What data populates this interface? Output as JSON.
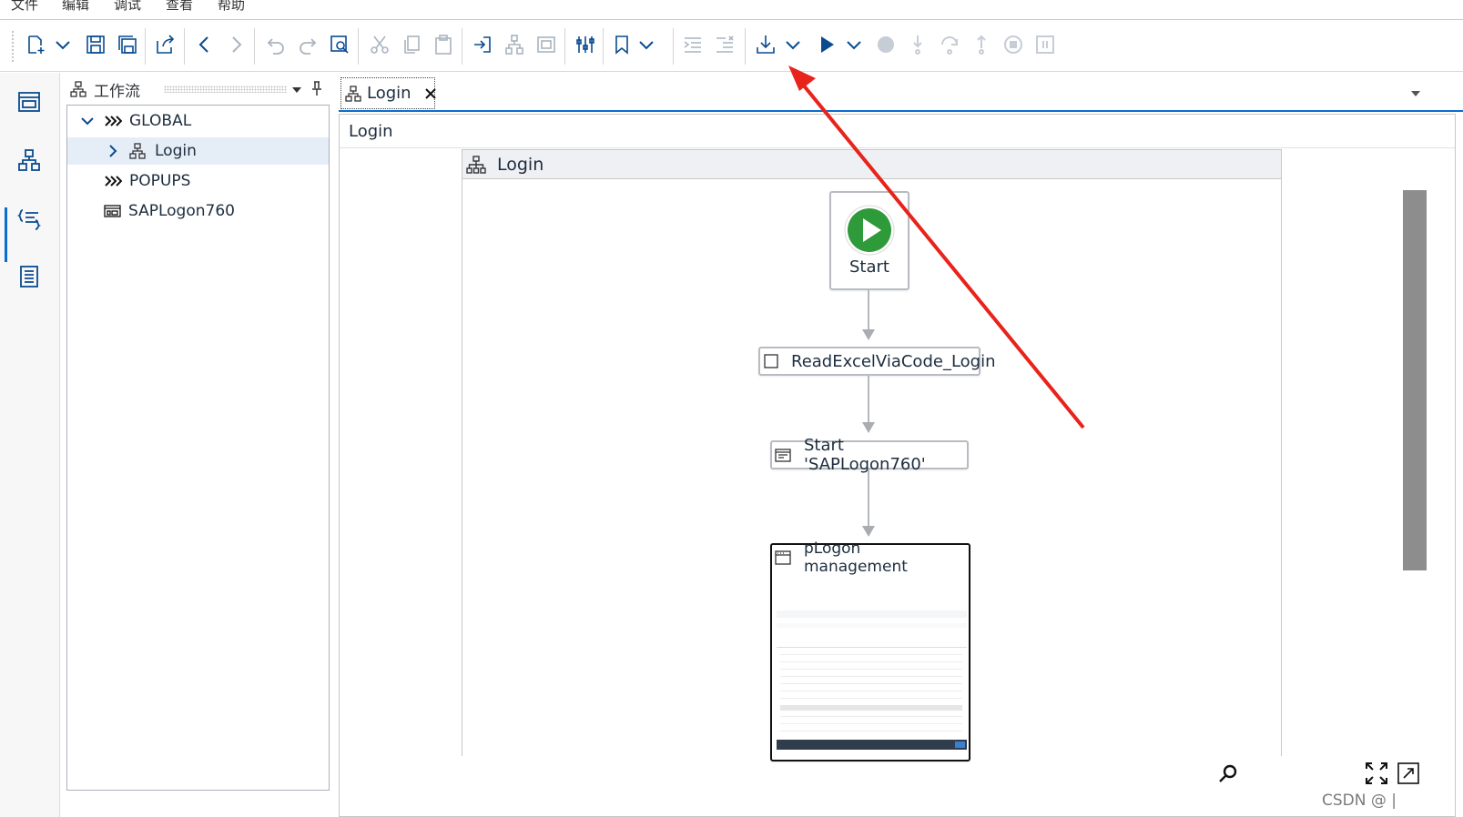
{
  "menu": [
    "文件",
    "编辑",
    "调试",
    "查看",
    "帮助"
  ],
  "toolbar_icons": [
    "new-file-icon",
    "dropdown-icon",
    "save-icon",
    "save-all-icon",
    "export-icon",
    "back-icon",
    "forward-icon",
    "undo-icon",
    "redo-icon",
    "find-icon",
    "cut-icon",
    "copy-icon",
    "paste-icon",
    "insert-icon",
    "group-icon",
    "frame-icon",
    "settings-sliders-icon",
    "bookmark-icon",
    "indent-icon",
    "outdent-icon",
    "download-deploy-icon",
    "run-icon",
    "breakpoint-icon",
    "step-into-icon",
    "step-over-icon",
    "step-out-icon",
    "stop-icon",
    "pause-icon"
  ],
  "workflow_panel": {
    "title": "工作流",
    "tree": [
      {
        "label": "GLOBAL",
        "expanded": true
      },
      {
        "label": "Login",
        "selected": true
      },
      {
        "label": "POPUPS"
      },
      {
        "label": "SAPLogon760"
      }
    ]
  },
  "editor": {
    "tab_label": "Login",
    "breadcrumb": "Login",
    "lane_title": "Login",
    "steps": {
      "start": "Start",
      "read_excel": "ReadExcelViaCode_Login",
      "start_app": "Start 'SAPLogon760'",
      "screen": "pLogon management"
    }
  },
  "watermark": "CSDN @ |",
  "colors": {
    "accent": "#0a6ed1",
    "start_green": "#2e9a3a",
    "annotation_red": "#e8231b"
  }
}
